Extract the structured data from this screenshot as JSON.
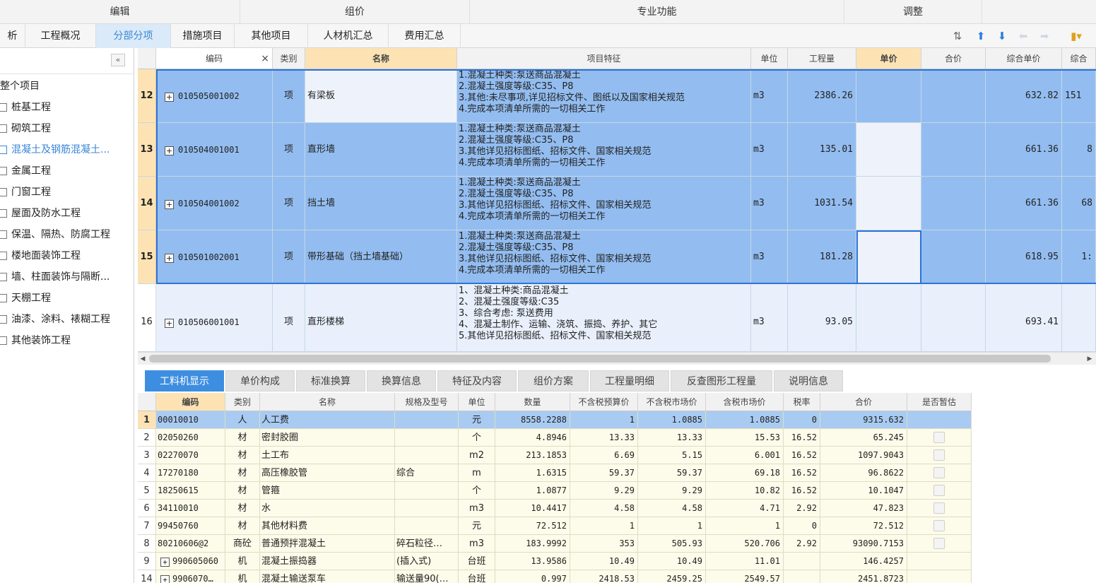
{
  "ribbon": [
    "编辑",
    "组价",
    "专业功能",
    "调整"
  ],
  "tabs": [
    "析",
    "工程概况",
    "分部分项",
    "措施项目",
    "其他项目",
    "人材机汇总",
    "费用汇总"
  ],
  "toolbar_icons": [
    "sort-icon",
    "arrow-up-icon",
    "arrow-down-icon",
    "arrow-left-icon",
    "arrow-right-icon",
    "palette-icon"
  ],
  "tree": {
    "root": "整个项目",
    "items": [
      "桩基工程",
      "砌筑工程",
      "混凝土及钢筋混凝土...",
      "金属工程",
      "门窗工程",
      "屋面及防水工程",
      "保温、隔热、防腐工程",
      "楼地面装饰工程",
      "墙、柱面装饰与隔断...",
      "天棚工程",
      "油漆、涂料、裱糊工程",
      "其他装饰工程"
    ],
    "active_index": 2
  },
  "upper": {
    "headers": {
      "code": "编码",
      "close": "×",
      "type": "类别",
      "name": "名称",
      "feature": "项目特征",
      "unit": "单位",
      "qty": "工程量",
      "price": "单价",
      "total": "合价",
      "comp_price": "综合单价",
      "comp_total": "综合"
    },
    "rows": [
      {
        "num": "12",
        "code": "010505001002",
        "type": "项",
        "name": "有梁板",
        "feature": [
          "1.混凝土种类:泵送商品混凝土",
          "2.混凝土强度等级:C35、P8",
          "3.其他:未尽事项,详见招标文件、图纸以及国家相关规范",
          "4.完成本项清单所需的一切相关工作"
        ],
        "unit": "m3",
        "qty": "2386.26",
        "comp_price": "632.82",
        "comp_total": "151"
      },
      {
        "num": "13",
        "code": "010504001001",
        "type": "项",
        "name": "直形墙",
        "feature": [
          "1.混凝土种类:泵送商品混凝土",
          "2.混凝土强度等级:C35、P8",
          "3.其他详见招标图纸、招标文件、国家相关规范",
          "4.完成本项清单所需的一切相关工作"
        ],
        "unit": "m3",
        "qty": "135.01",
        "comp_price": "661.36",
        "comp_total": "8"
      },
      {
        "num": "14",
        "code": "010504001002",
        "type": "项",
        "name": "挡土墙",
        "feature": [
          "1.混凝土种类:泵送商品混凝土",
          "2.混凝土强度等级:C35、P8",
          "3.其他详见招标图纸、招标文件、国家相关规范",
          "4.完成本项清单所需的一切相关工作"
        ],
        "unit": "m3",
        "qty": "1031.54",
        "comp_price": "661.36",
        "comp_total": "68"
      },
      {
        "num": "15",
        "code": "010501002001",
        "type": "项",
        "name": "带形基础（挡土墙基础）",
        "feature": [
          "1.混凝土种类:泵送商品混凝土",
          "2.混凝土强度等级:C35、P8",
          "3.其他详见招标图纸、招标文件、国家相关规范",
          "4.完成本项清单所需的一切相关工作"
        ],
        "unit": "m3",
        "qty": "181.28",
        "comp_price": "618.95",
        "comp_total": "1:"
      },
      {
        "num": "16",
        "code": "010506001001",
        "type": "项",
        "name": "直形楼梯",
        "feature": [
          "1、混凝土种类:商品混凝土",
          "2、混凝土强度等级:C35",
          "3、综合考虑: 泵送费用",
          "4、混凝土制作、运输、浇筑、振捣、养护、其它",
          "5.其他详见招标图纸、招标文件、国家相关规范"
        ],
        "unit": "m3",
        "qty": "93.05",
        "comp_price": "693.41",
        "comp_total": ""
      }
    ]
  },
  "bottom_tabs": [
    "工料机显示",
    "单价构成",
    "标准换算",
    "换算信息",
    "特征及内容",
    "组价方案",
    "工程量明细",
    "反查图形工程量",
    "说明信息"
  ],
  "lower": {
    "headers": [
      "编码",
      "类别",
      "名称",
      "规格及型号",
      "单位",
      "数量",
      "不含税预算价",
      "不含税市场价",
      "含税市场价",
      "税率",
      "合价",
      "是否暂估"
    ],
    "rows": [
      {
        "num": "1",
        "code": "00010010",
        "type": "人",
        "name": "人工费",
        "spec": "",
        "unit": "元",
        "qty": "8558.2288",
        "pre": "1",
        "mkt": "1.0885",
        "tax_mkt": "1.0885",
        "rate": "0",
        "total": "9315.632",
        "chk": false
      },
      {
        "num": "2",
        "code": "02050260",
        "type": "材",
        "name": "密封胶圈",
        "spec": "",
        "unit": "个",
        "qty": "4.8946",
        "pre": "13.33",
        "mkt": "13.33",
        "tax_mkt": "15.53",
        "rate": "16.52",
        "total": "65.245",
        "chk": true
      },
      {
        "num": "3",
        "code": "02270070",
        "type": "材",
        "name": "土工布",
        "spec": "",
        "unit": "m2",
        "qty": "213.1853",
        "pre": "6.69",
        "mkt": "5.15",
        "tax_mkt": "6.001",
        "rate": "16.52",
        "total": "1097.9043",
        "chk": true
      },
      {
        "num": "4",
        "code": "17270180",
        "type": "材",
        "name": "高压橡胶管",
        "spec": "综合",
        "unit": "m",
        "qty": "1.6315",
        "pre": "59.37",
        "mkt": "59.37",
        "tax_mkt": "69.18",
        "rate": "16.52",
        "total": "96.8622",
        "chk": true
      },
      {
        "num": "5",
        "code": "18250615",
        "type": "材",
        "name": "管箍",
        "spec": "",
        "unit": "个",
        "qty": "1.0877",
        "pre": "9.29",
        "mkt": "9.29",
        "tax_mkt": "10.82",
        "rate": "16.52",
        "total": "10.1047",
        "chk": true
      },
      {
        "num": "6",
        "code": "34110010",
        "type": "材",
        "name": "水",
        "spec": "",
        "unit": "m3",
        "qty": "10.4417",
        "pre": "4.58",
        "mkt": "4.58",
        "tax_mkt": "4.71",
        "rate": "2.92",
        "total": "47.823",
        "chk": true
      },
      {
        "num": "7",
        "code": "99450760",
        "type": "材",
        "name": "其他材料费",
        "spec": "",
        "unit": "元",
        "qty": "72.512",
        "pre": "1",
        "mkt": "1",
        "tax_mkt": "1",
        "rate": "0",
        "total": "72.512",
        "chk": true
      },
      {
        "num": "8",
        "code": "80210606@2",
        "type": "商砼",
        "name": "普通预拌混凝土",
        "spec": "碎石粒径…",
        "unit": "m3",
        "qty": "183.9992",
        "pre": "353",
        "mkt": "505.93",
        "tax_mkt": "520.706",
        "rate": "2.92",
        "total": "93090.7153",
        "chk": true
      },
      {
        "num": "9",
        "code": "990605060",
        "type": "机",
        "name": "混凝土振捣器",
        "spec": "(插入式)",
        "unit": "台班",
        "qty": "13.9586",
        "pre": "10.49",
        "mkt": "10.49",
        "tax_mkt": "11.01",
        "rate": "",
        "total": "146.4257",
        "chk": false,
        "plus": true
      },
      {
        "num": "14",
        "code": "9906070…",
        "type": "机",
        "name": "混凝土输送泵车",
        "spec": "输送量90(…",
        "unit": "台班",
        "qty": "0.997",
        "pre": "2418.53",
        "mkt": "2459.25",
        "tax_mkt": "2549.57",
        "rate": "",
        "total": "2451.8723",
        "chk": false,
        "plus": true
      }
    ]
  }
}
